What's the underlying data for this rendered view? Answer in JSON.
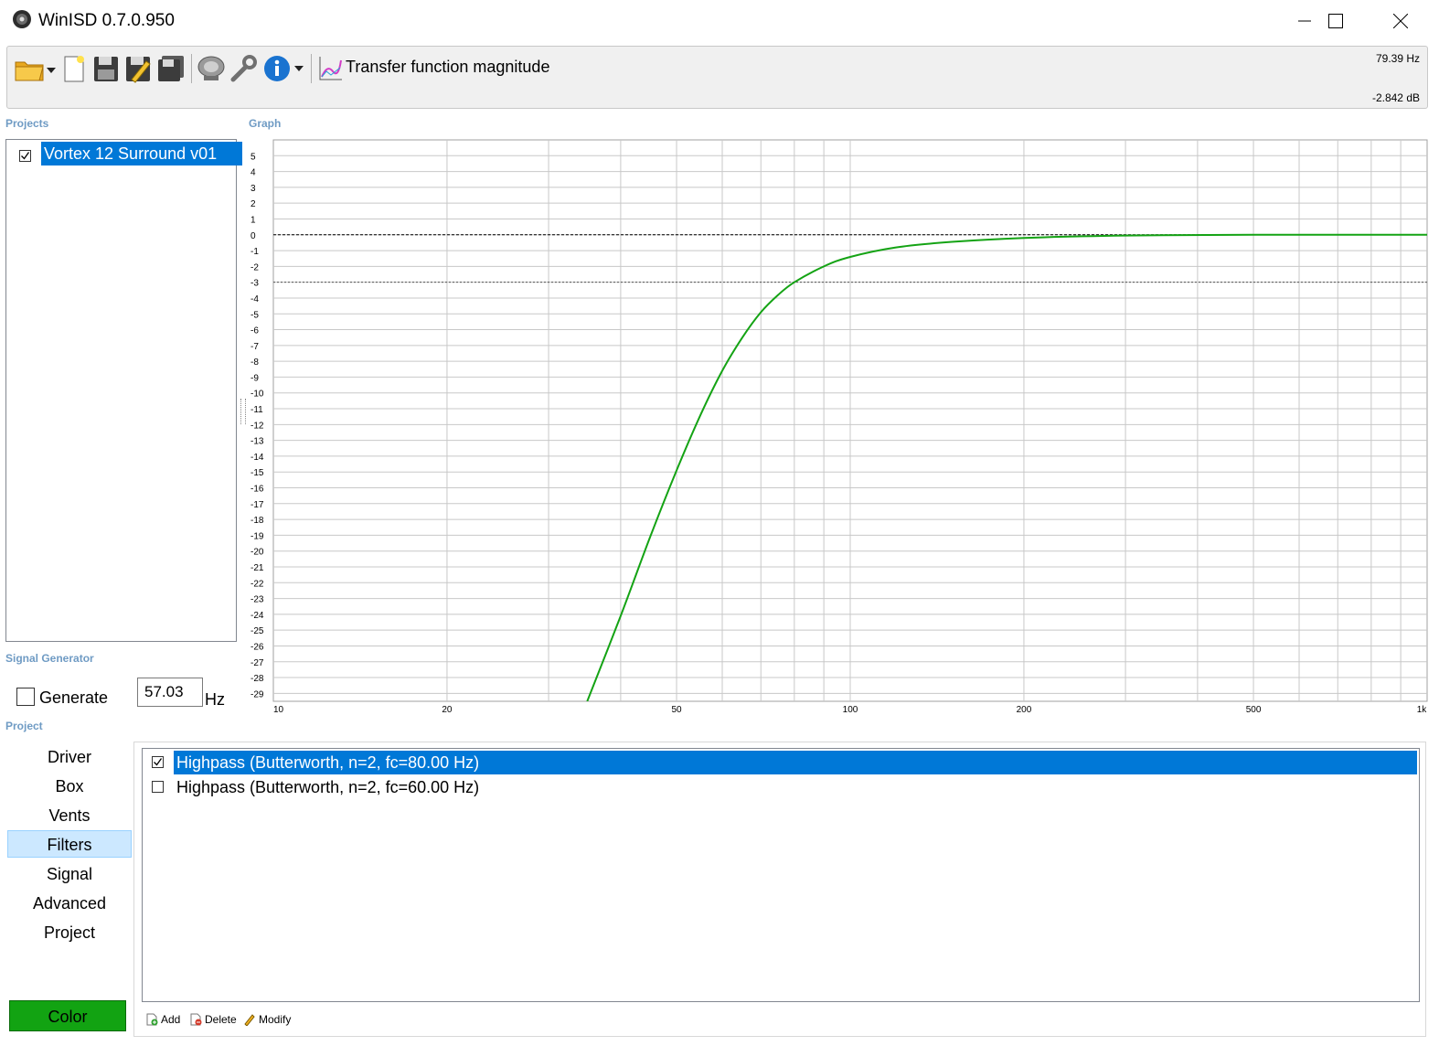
{
  "window": {
    "title": "WinISD 0.7.0.950"
  },
  "toolbar": {
    "title": "Transfer function magnitude",
    "readout_freq": "79.39 Hz",
    "readout_db": "-2.842 dB",
    "icons": [
      "open-folder-icon",
      "new-document-icon",
      "save-icon",
      "save-edit-icon",
      "save-all-icon",
      "driver-icon",
      "wrench-icon",
      "info-icon",
      "chart-icon"
    ]
  },
  "sections": {
    "projects": "Projects",
    "graph": "Graph",
    "signal_generator": "Signal Generator",
    "project": "Project"
  },
  "projects": [
    {
      "name": "Vortex 12 Surround v01",
      "checked": true,
      "selected": true
    }
  ],
  "signal_generator": {
    "generate_label": "Generate",
    "checked": false,
    "frequency": "57.03",
    "unit": "Hz"
  },
  "nav": {
    "items": [
      "Driver",
      "Box",
      "Vents",
      "Filters",
      "Signal",
      "Advanced",
      "Project"
    ],
    "active": "Filters"
  },
  "color_button": {
    "label": "Color",
    "color": "#12a312"
  },
  "filters": [
    {
      "label": "Highpass (Butterworth, n=2, fc=80.00 Hz)",
      "checked": true,
      "selected": true
    },
    {
      "label": "Highpass (Butterworth, n=2, fc=60.00 Hz)",
      "checked": false,
      "selected": false
    }
  ],
  "actions": {
    "add": "Add",
    "delete": "Delete",
    "modify": "Modify"
  },
  "chart_data": {
    "type": "line",
    "xlog": true,
    "xlim": [
      10,
      1000
    ],
    "ylim": [
      -29.5,
      6
    ],
    "x_ticks": [
      10,
      20,
      50,
      100,
      200,
      500,
      1000
    ],
    "x_tick_labels": [
      "10",
      "20",
      "50",
      "100",
      "200",
      "500",
      "1k"
    ],
    "y_ticks": [
      5,
      4,
      3,
      2,
      1,
      0,
      -1,
      -2,
      -3,
      -4,
      -5,
      -6,
      -7,
      -8,
      -9,
      -10,
      -11,
      -12,
      -13,
      -14,
      -15,
      -16,
      -17,
      -18,
      -19,
      -20,
      -21,
      -22,
      -23,
      -24,
      -25,
      -26,
      -27,
      -28,
      -29
    ],
    "reference_lines": [
      0,
      -3
    ],
    "grid": true,
    "series": [
      {
        "color": "#14a314",
        "x": [
          35,
          40,
          45,
          50,
          55,
          60,
          65,
          70,
          75,
          80,
          90,
          100,
          120,
          150,
          200,
          300,
          500,
          700,
          1000
        ],
        "y": [
          -29.5,
          -24.1,
          -19.1,
          -14.9,
          -11.4,
          -8.6,
          -6.5,
          -4.9,
          -3.8,
          -3.0,
          -2.0,
          -1.4,
          -0.8,
          -0.45,
          -0.2,
          -0.05,
          0.0,
          0.0,
          0.0
        ]
      }
    ]
  }
}
